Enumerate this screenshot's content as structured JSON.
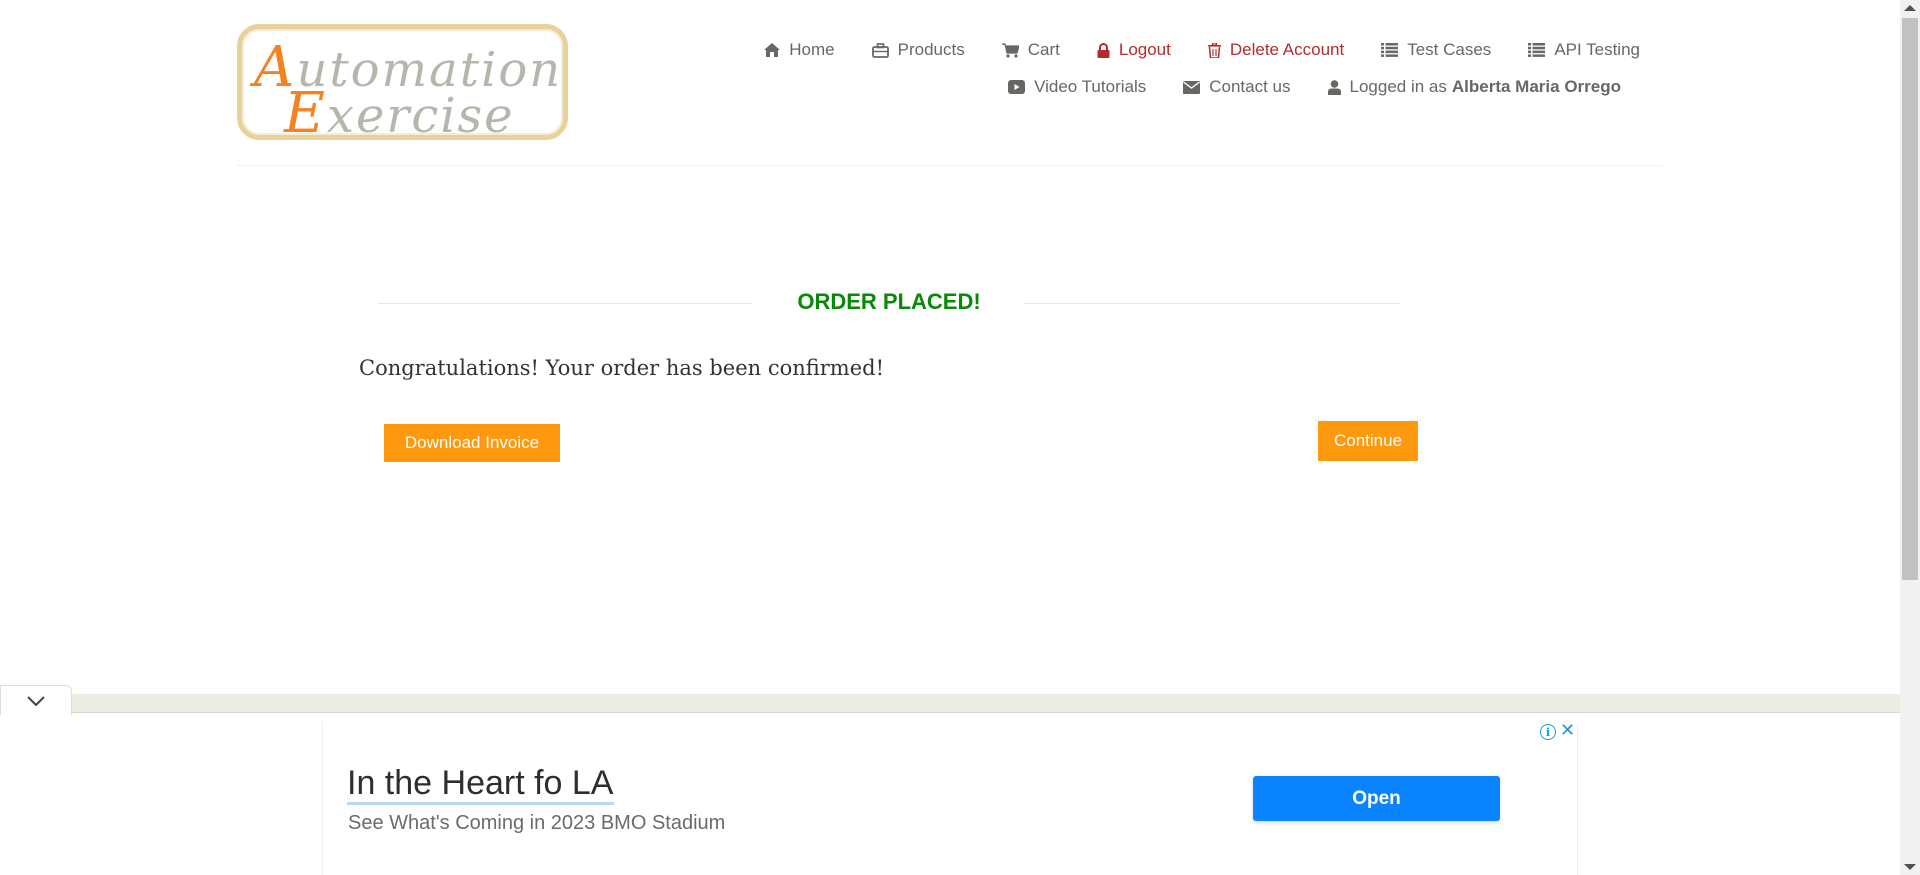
{
  "logo": {
    "line1_cap": "A",
    "line1_rest": "utomation",
    "line2_cap": "E",
    "line2_rest": "xercise",
    "colors": {
      "cap": "#f58220",
      "text": "#b8b5ad",
      "border": "#e8d29c"
    }
  },
  "nav": {
    "home": "Home",
    "products": "Products",
    "cart": "Cart",
    "logout": "Logout",
    "delete_account": "Delete Account",
    "test_cases": "Test Cases",
    "api_testing": "API Testing",
    "video_tutorials": "Video Tutorials",
    "contact_us": "Contact us",
    "logged_in_prefix": "Logged in as",
    "logged_in_user": "Alberta Maria Orrego",
    "icons": [
      "home-icon",
      "briefcase-icon",
      "cart-icon",
      "lock-icon",
      "trash-icon",
      "list-icon",
      "list-icon",
      "youtube-icon",
      "envelope-icon",
      "user-icon"
    ]
  },
  "main": {
    "title": "ORDER PLACED!",
    "message": "Congratulations! Your order has been confirmed!",
    "download_button": "Download Invoice",
    "continue_button": "Continue",
    "title_color": "#078a07",
    "button_color": "#fe980f"
  },
  "ad": {
    "headline": "In the Heart fo LA",
    "subtext": "See What's Coming in 2023 BMO Stadium",
    "open_button": "Open",
    "close_label": "✕",
    "info_label": "i",
    "button_color": "#0a84ff"
  }
}
